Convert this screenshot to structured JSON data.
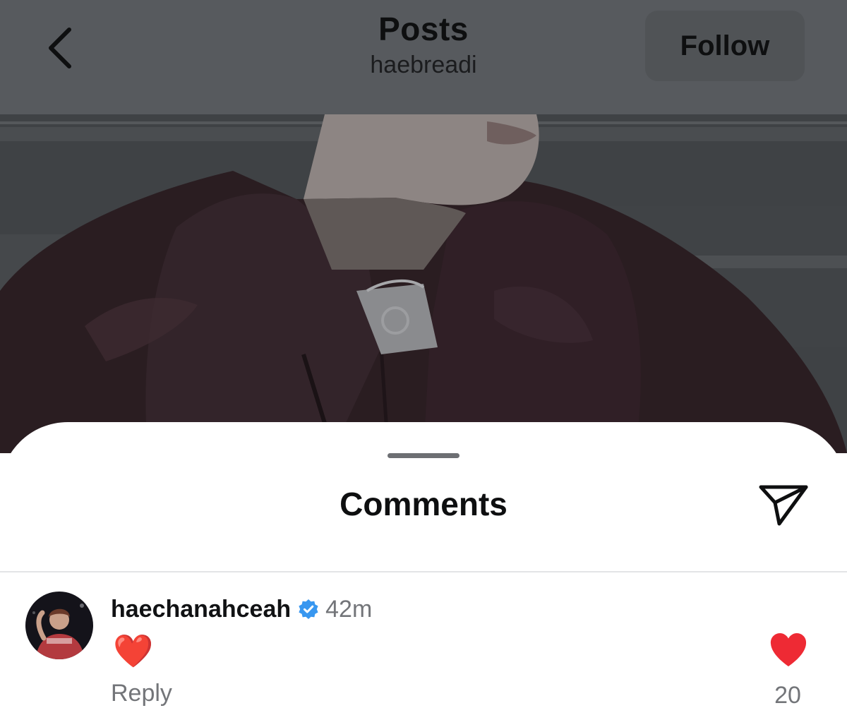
{
  "header": {
    "title": "Posts",
    "username": "haebreadi",
    "follow_label": "Follow",
    "back_icon": "chevron-left-icon",
    "background": "#575a5e"
  },
  "post": {
    "image": "dimmed photo of a person in a dark burgundy leather jacket"
  },
  "comments_sheet": {
    "title": "Comments",
    "share_icon": "paper-plane-icon",
    "comments": [
      {
        "username": "haechanahceah",
        "verified": true,
        "time": "42m",
        "text": "❤️",
        "reply_label": "Reply",
        "like_count": "20",
        "liked": true
      }
    ]
  },
  "colors": {
    "like_red": "#ee2a34",
    "verified_blue": "#3897f0",
    "secondary_text": "#737579"
  }
}
